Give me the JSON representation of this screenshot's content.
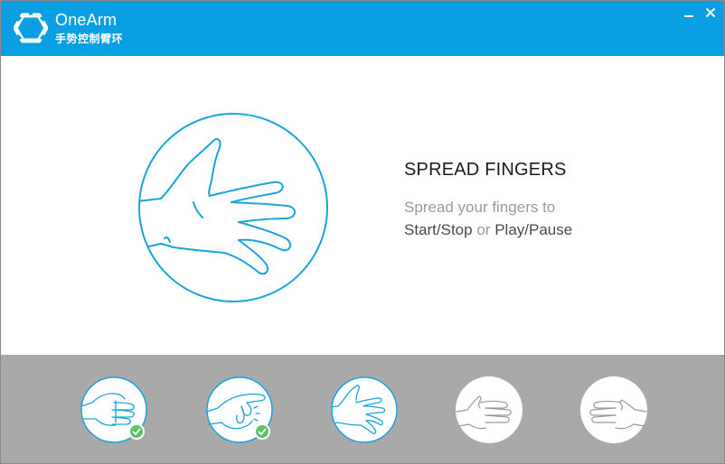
{
  "app": {
    "name": "OneArm",
    "subtitle": "手势控制臂环",
    "accent_color": "#0a9fe3"
  },
  "window_controls": {
    "minimize_icon": "minimize-icon",
    "close_icon": "close-icon"
  },
  "gesture": {
    "title": "SPREAD FINGERS",
    "desc_line1": "Spread your fingers to",
    "action1": "Start/Stop",
    "connector": "or",
    "action2": "Play/Pause",
    "icon": "spread-fingers-icon"
  },
  "gesture_list": [
    {
      "name": "fist",
      "completed": true,
      "active": false
    },
    {
      "name": "pinch",
      "completed": true,
      "active": false
    },
    {
      "name": "spread-fingers",
      "completed": false,
      "active": true
    },
    {
      "name": "wave-in",
      "completed": false,
      "active": false
    },
    {
      "name": "wave-out",
      "completed": false,
      "active": false
    }
  ],
  "colors": {
    "gesture_bar": "#a9a9a9",
    "check": "#5dc26a",
    "line": "#1ba3e0"
  }
}
